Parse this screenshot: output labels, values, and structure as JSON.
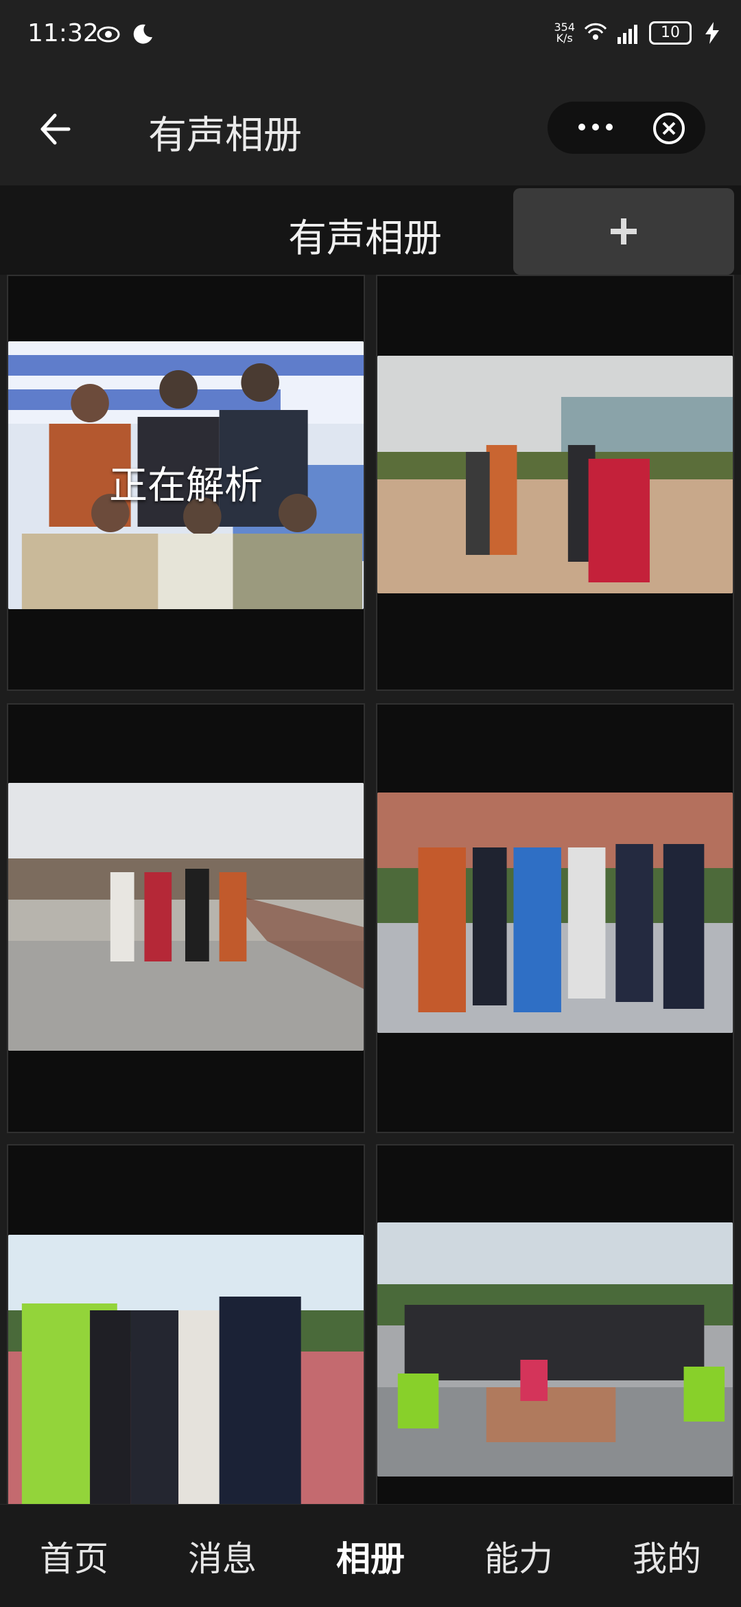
{
  "status_bar": {
    "time": "11:32",
    "net_speed_top": "354",
    "net_speed_bottom": "K/s",
    "battery": "10"
  },
  "header": {
    "title": "有声相册"
  },
  "subheader": {
    "title": "有声相册",
    "add_label": "+"
  },
  "gallery": {
    "status_text": "正在解析",
    "photos": [
      {
        "id": "p1"
      },
      {
        "id": "p2"
      },
      {
        "id": "p3"
      },
      {
        "id": "p4"
      },
      {
        "id": "p5"
      },
      {
        "id": "p6"
      }
    ]
  },
  "bottom_nav": {
    "items": [
      {
        "label": "首页"
      },
      {
        "label": "消息"
      },
      {
        "label": "相册"
      },
      {
        "label": "能力"
      },
      {
        "label": "我的"
      }
    ],
    "active_index": 2
  },
  "icons": {
    "back": "back-arrow-icon",
    "more": "more-dots-icon",
    "close": "close-circle-icon",
    "plus": "plus-icon",
    "eye": "eye-icon",
    "moon": "moon-icon",
    "wifi": "wifi-icon",
    "signal": "signal-icon",
    "charging": "lightning-icon"
  },
  "colors": {
    "background": "#1d1d1d",
    "header_bg": "#212121",
    "add_button_bg": "#3a3a3a",
    "text": "#f0f0f0"
  }
}
